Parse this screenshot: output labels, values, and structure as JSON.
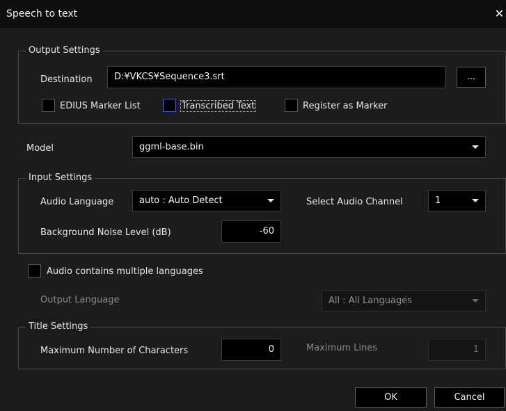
{
  "window": {
    "title": "Speech to text",
    "close_symbol": "✕"
  },
  "output_settings": {
    "legend": "Output Settings",
    "destination_label": "Destination",
    "destination_value": "D:¥VKCS¥Sequence3.srt",
    "browse_label": "...",
    "checkbox_edius_marker_list": "EDIUS Marker List",
    "checkbox_transcribed_text": "Transcribed Text",
    "checkbox_register_as_marker": "Register as Marker"
  },
  "model": {
    "label": "Model",
    "value": "ggml-base.bin"
  },
  "input_settings": {
    "legend": "Input Settings",
    "audio_language_label": "Audio Language",
    "audio_language_value": "auto : Auto Detect",
    "audio_channel_label": "Select Audio Channel",
    "audio_channel_value": "1",
    "noise_label": "Background Noise Level (dB)",
    "noise_value": "-60"
  },
  "multi_language": {
    "checkbox_label": "Audio contains multiple languages",
    "output_language_label": "Output Language",
    "output_language_value": "All : All Languages"
  },
  "title_settings": {
    "legend": "Title Settings",
    "max_chars_label": "Maximum Number of Characters",
    "max_chars_value": "0",
    "max_lines_label": "Maximum Lines",
    "max_lines_value": "1"
  },
  "buttons": {
    "ok": "OK",
    "cancel": "Cancel"
  },
  "colors": {
    "background": "#1c1c1c",
    "titlebar": "#0f0f0f",
    "field": "#000000",
    "focus_border": "#3a5fd8"
  }
}
